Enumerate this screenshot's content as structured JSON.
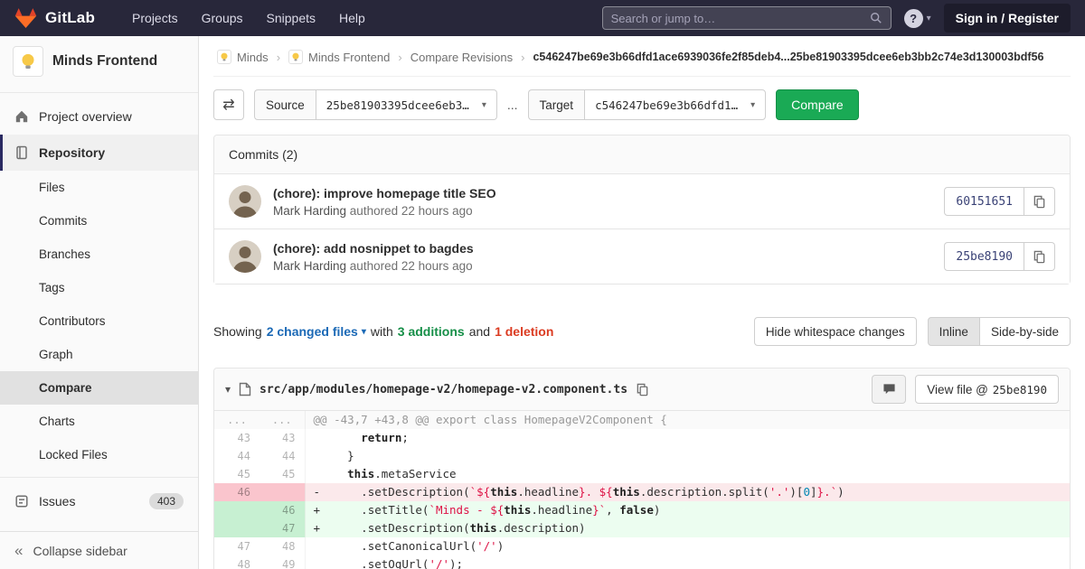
{
  "icons": {
    "swap": "⇄",
    "caret_down": "▾",
    "collapse": "«",
    "crumb_separator": "›"
  },
  "navbar": {
    "brand": "GitLab",
    "menu": [
      "Projects",
      "Groups",
      "Snippets",
      "Help"
    ],
    "search_placeholder": "Search or jump to…",
    "help": "?",
    "sign_in": "Sign in / Register"
  },
  "sidebar": {
    "project": "Minds Frontend",
    "overview": "Project overview",
    "repository": "Repository",
    "repo_items": [
      "Files",
      "Commits",
      "Branches",
      "Tags",
      "Contributors",
      "Graph",
      "Compare",
      "Charts",
      "Locked Files"
    ],
    "active_item": "Compare",
    "issues": "Issues",
    "issues_count": "403",
    "collapse": "Collapse sidebar"
  },
  "breadcrumb": {
    "items": [
      {
        "label": "Minds",
        "avatar": true
      },
      {
        "label": "Minds Frontend",
        "avatar": true
      },
      {
        "label": "Compare Revisions",
        "avatar": false
      }
    ],
    "current": "c546247be69e3b66dfd1ace6939036fe2f85deb4...25be81903395dcee6eb3bb2c74e3d130003bdf56"
  },
  "compare": {
    "source_label": "Source",
    "source_value": "25be81903395dcee6eb3…",
    "ellipsis": "...",
    "target_label": "Target",
    "target_value": "c546247be69e3b66dfd1…",
    "button": "Compare"
  },
  "commits": {
    "title": "Commits (2)",
    "list": [
      {
        "title": "(chore): improve homepage title SEO",
        "author": "Mark Harding",
        "meta": "authored 22 hours ago",
        "sha": "60151651"
      },
      {
        "title": "(chore): add nosnippet to bagdes",
        "author": "Mark Harding",
        "meta": "authored 22 hours ago",
        "sha": "25be8190"
      }
    ]
  },
  "summary": {
    "showing": "Showing",
    "files": "2 changed files",
    "with": "with",
    "additions": "3 additions",
    "and": "and",
    "deletion": "1 deletion",
    "hide_whitespace": "Hide whitespace changes",
    "inline": "Inline",
    "side_by_side": "Side-by-side"
  },
  "diff": {
    "path": "src/app/modules/homepage-v2/homepage-v2.component.ts",
    "view_file": "View file @",
    "view_sha": "25be8190",
    "rows": [
      {
        "type": "hunk",
        "old": "...",
        "new": "...",
        "tokens": [
          [
            "@@ -43,7 +43,8 @@ export class HomepageV2Component {",
            "h"
          ]
        ]
      },
      {
        "type": "ctx",
        "old": "43",
        "new": "43",
        "tokens": [
          [
            "      ",
            "p"
          ],
          [
            "return",
            "k"
          ],
          [
            ";",
            "p"
          ]
        ]
      },
      {
        "type": "ctx",
        "old": "44",
        "new": "44",
        "tokens": [
          [
            "    }",
            "p"
          ]
        ]
      },
      {
        "type": "ctx",
        "old": "45",
        "new": "45",
        "tokens": [
          [
            "    ",
            "p"
          ],
          [
            "this",
            "k"
          ],
          [
            ".metaService",
            "p"
          ]
        ]
      },
      {
        "type": "del",
        "old": "46",
        "new": "",
        "sign": "-",
        "tokens": [
          [
            "      .setDescription(",
            "p"
          ],
          [
            "`",
            "s"
          ],
          [
            "${",
            "si"
          ],
          [
            "this",
            "k"
          ],
          [
            ".headline",
            "p"
          ],
          [
            "}",
            "si"
          ],
          [
            ". ",
            "s"
          ],
          [
            "${",
            "si"
          ],
          [
            "this",
            "k"
          ],
          [
            ".description.split(",
            "p"
          ],
          [
            "'.'",
            "s"
          ],
          [
            ")[",
            "p"
          ],
          [
            "0",
            "n"
          ],
          [
            "]",
            "p"
          ],
          [
            "}",
            "si"
          ],
          [
            ".`",
            "s"
          ],
          [
            ")",
            "p"
          ]
        ]
      },
      {
        "type": "add",
        "old": "",
        "new": "46",
        "sign": "+",
        "tokens": [
          [
            "      .setTitle(",
            "p"
          ],
          [
            "`Minds - ",
            "s"
          ],
          [
            "${",
            "si"
          ],
          [
            "this",
            "k"
          ],
          [
            ".headline",
            "p"
          ],
          [
            "}",
            "si"
          ],
          [
            "`",
            "s"
          ],
          [
            ", ",
            "p"
          ],
          [
            "false",
            "k"
          ],
          [
            ")",
            "p"
          ]
        ]
      },
      {
        "type": "add",
        "old": "",
        "new": "47",
        "sign": "+",
        "tokens": [
          [
            "      .setDescription(",
            "p"
          ],
          [
            "this",
            "k"
          ],
          [
            ".description)",
            "p"
          ]
        ]
      },
      {
        "type": "ctx",
        "old": "47",
        "new": "48",
        "tokens": [
          [
            "      .setCanonicalUrl(",
            "p"
          ],
          [
            "'/'",
            "s"
          ],
          [
            ")",
            "p"
          ]
        ]
      },
      {
        "type": "ctx",
        "old": "48",
        "new": "49",
        "tokens": [
          [
            "      .setOgUrl(",
            "p"
          ],
          [
            "'/'",
            "s"
          ],
          [
            ");",
            "p"
          ]
        ]
      }
    ]
  },
  "colors": {
    "navbar_bg": "#28273a",
    "accent_green": "#1aaa55",
    "addition_text": "#168f48",
    "deletion_text": "#db3b21",
    "link_blue": "#1b69b6"
  }
}
